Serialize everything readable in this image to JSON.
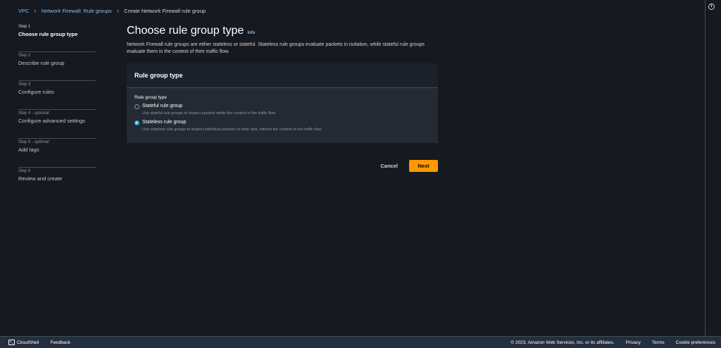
{
  "breadcrumb": {
    "items": [
      "VPC",
      "Network Firewall: Rule groups"
    ],
    "current": "Create Network Firewall rule group"
  },
  "steps": [
    {
      "num": "Step 1",
      "optional": "",
      "title": "Choose rule group type"
    },
    {
      "num": "Step 2",
      "optional": "",
      "title": "Describe rule group"
    },
    {
      "num": "Step 3",
      "optional": "",
      "title": "Configure rules"
    },
    {
      "num": "Step 4 - ",
      "optional": "optional",
      "title": "Configure advanced settings"
    },
    {
      "num": "Step 5 - ",
      "optional": "optional",
      "title": "Add tags"
    },
    {
      "num": "Step 6",
      "optional": "",
      "title": "Review and create"
    }
  ],
  "main": {
    "title": "Choose rule group type",
    "info_link": "Info",
    "description": "Network Firewall rule groups are either stateless or stateful. Stateless rule groups evaluate packets in isolation, while stateful rule groups evaluate them in the context of their traffic flow.",
    "container_title": "Rule group type",
    "field_label": "Rule group type",
    "options": [
      {
        "label": "Stateful rule group",
        "desc": "Use stateful rule groups to inspect packets within the context of the traffic flow.",
        "checked": false
      },
      {
        "label": "Stateless rule group",
        "desc": "Use stateless rule groups to inspect individual packets on their own, without the context of the traffic flow.",
        "checked": true
      }
    ]
  },
  "actions": {
    "cancel_label": "Cancel",
    "next_label": "Next"
  },
  "footer": {
    "cloudshell": "CloudShell",
    "feedback": "Feedback",
    "copyright": "© 2023, Amazon Web Services, Inc. or its affiliates.",
    "privacy": "Privacy",
    "terms": "Terms",
    "cookie": "Cookie preferences"
  },
  "colors": {
    "accent": "#ff9900",
    "link": "#89bdee",
    "radio_checked": "#2ea8e5",
    "background": "#16191f"
  },
  "icons": {
    "info": "info-circle-icon",
    "cloudshell": "terminal-icon"
  }
}
